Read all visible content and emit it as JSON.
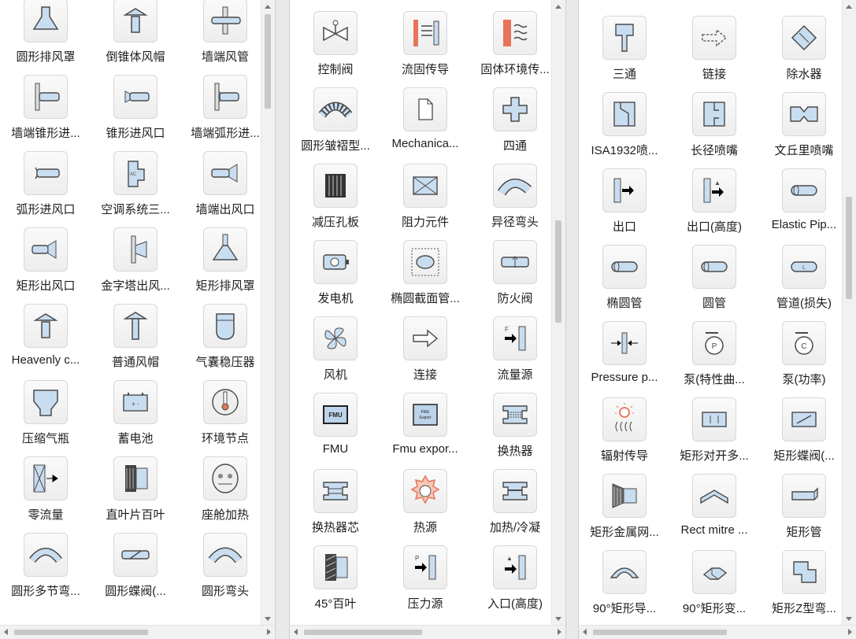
{
  "colors": {
    "stroke": "#4a4a4a",
    "fill": "#c9ddf0",
    "accent": "#e8735a",
    "tile_bg": "#f4f4f4"
  },
  "panels": [
    {
      "items": [
        {
          "label": "圆形排风罩",
          "icon": "funnel-hood"
        },
        {
          "label": "倒锥体风帽",
          "icon": "cowl-cap"
        },
        {
          "label": "墙端风管",
          "icon": "wall-duct"
        },
        {
          "label": "墙端锥形进...",
          "icon": "wall-cone-inlet"
        },
        {
          "label": "锥形进风口",
          "icon": "cone-inlet"
        },
        {
          "label": "墙端弧形进...",
          "icon": "wall-arc-inlet"
        },
        {
          "label": "弧形进风口",
          "icon": "arc-inlet"
        },
        {
          "label": "空调系统三...",
          "icon": "ac-three-way"
        },
        {
          "label": "墙端出风口",
          "icon": "wall-outlet"
        },
        {
          "label": "矩形出风口",
          "icon": "rect-outlet"
        },
        {
          "label": "金字塔出风...",
          "icon": "pyramid-outlet"
        },
        {
          "label": "矩形排风罩",
          "icon": "rect-hood"
        },
        {
          "label": "Heavenly c...",
          "icon": "cowl-cap"
        },
        {
          "label": "普通风帽",
          "icon": "common-cap"
        },
        {
          "label": "气囊稳压器",
          "icon": "air-bag"
        },
        {
          "label": "压缩气瓶",
          "icon": "gas-bottle"
        },
        {
          "label": "蓄电池",
          "icon": "battery"
        },
        {
          "label": "环境节点",
          "icon": "thermometer"
        },
        {
          "label": "零流量",
          "icon": "zero-flow"
        },
        {
          "label": "直叶片百叶",
          "icon": "straight-louver"
        },
        {
          "label": "座舱加热",
          "icon": "cabin-heat"
        },
        {
          "label": "圆形多节弯...",
          "icon": "multi-bend"
        },
        {
          "label": "圆形蝶阀(...",
          "icon": "round-butterfly"
        },
        {
          "label": "圆形弯头",
          "icon": "round-elbow"
        }
      ]
    },
    {
      "items": [
        {
          "label": "控制阀",
          "icon": "control-valve"
        },
        {
          "label": "流固传导",
          "icon": "fluid-solid"
        },
        {
          "label": "固体环境传...",
          "icon": "solid-env"
        },
        {
          "label": "圆形皱褶型...",
          "icon": "pleated-bend"
        },
        {
          "label": "Mechanica...",
          "icon": "document"
        },
        {
          "label": "四通",
          "icon": "cross"
        },
        {
          "label": "减压孔板",
          "icon": "orifice-plate"
        },
        {
          "label": "阻力元件",
          "icon": "resistance"
        },
        {
          "label": "异径弯头",
          "icon": "reducing-elbow"
        },
        {
          "label": "发电机",
          "icon": "generator"
        },
        {
          "label": "椭圆截面管...",
          "icon": "ellipse-section"
        },
        {
          "label": "防火阀",
          "icon": "fire-damper"
        },
        {
          "label": "风机",
          "icon": "fan"
        },
        {
          "label": "连接",
          "icon": "link-arrow"
        },
        {
          "label": "流量源",
          "icon": "flow-source"
        },
        {
          "label": "FMU",
          "icon": "fmu"
        },
        {
          "label": "Fmu expor...",
          "icon": "fmu-export"
        },
        {
          "label": "换热器",
          "icon": "heat-exchanger"
        },
        {
          "label": "换热器芯",
          "icon": "hx-core"
        },
        {
          "label": "热源",
          "icon": "heat-source"
        },
        {
          "label": "加热/冷凝",
          "icon": "heat-cond"
        },
        {
          "label": "45°百叶",
          "icon": "louver-45"
        },
        {
          "label": "压力源",
          "icon": "pressure-source"
        },
        {
          "label": "入口(高度)",
          "icon": "inlet-height"
        }
      ]
    },
    {
      "items": [
        {
          "label": "三通",
          "icon": "tee"
        },
        {
          "label": "链接",
          "icon": "dashed-arrow"
        },
        {
          "label": "除水器",
          "icon": "water-separator"
        },
        {
          "label": "ISA1932喷...",
          "icon": "isa-nozzle"
        },
        {
          "label": "长径喷嘴",
          "icon": "long-nozzle"
        },
        {
          "label": "文丘里喷嘴",
          "icon": "venturi"
        },
        {
          "label": "出口",
          "icon": "outlet"
        },
        {
          "label": "出口(高度)",
          "icon": "outlet-height"
        },
        {
          "label": "Elastic Pip...",
          "icon": "pipe"
        },
        {
          "label": "椭圆管",
          "icon": "pipe"
        },
        {
          "label": "圆管",
          "icon": "pipe"
        },
        {
          "label": "管道(损失)",
          "icon": "pipe-loss"
        },
        {
          "label": "Pressure p...",
          "icon": "pressure-point"
        },
        {
          "label": "泵(特性曲...",
          "icon": "pump-p"
        },
        {
          "label": "泵(功率)",
          "icon": "pump-c"
        },
        {
          "label": "辐射传导",
          "icon": "radiation"
        },
        {
          "label": "矩形对开多...",
          "icon": "rect-opposed"
        },
        {
          "label": "矩形蝶阀(...",
          "icon": "rect-butterfly"
        },
        {
          "label": "矩形金属网...",
          "icon": "metal-mesh"
        },
        {
          "label": "Rect mitre ...",
          "icon": "rect-mitre"
        },
        {
          "label": "矩形管",
          "icon": "rect-pipe"
        },
        {
          "label": "90°矩形导...",
          "icon": "rect-guide-90"
        },
        {
          "label": "90°矩形变...",
          "icon": "rect-trans-90"
        },
        {
          "label": "矩形Z型弯...",
          "icon": "z-bend"
        }
      ]
    }
  ]
}
